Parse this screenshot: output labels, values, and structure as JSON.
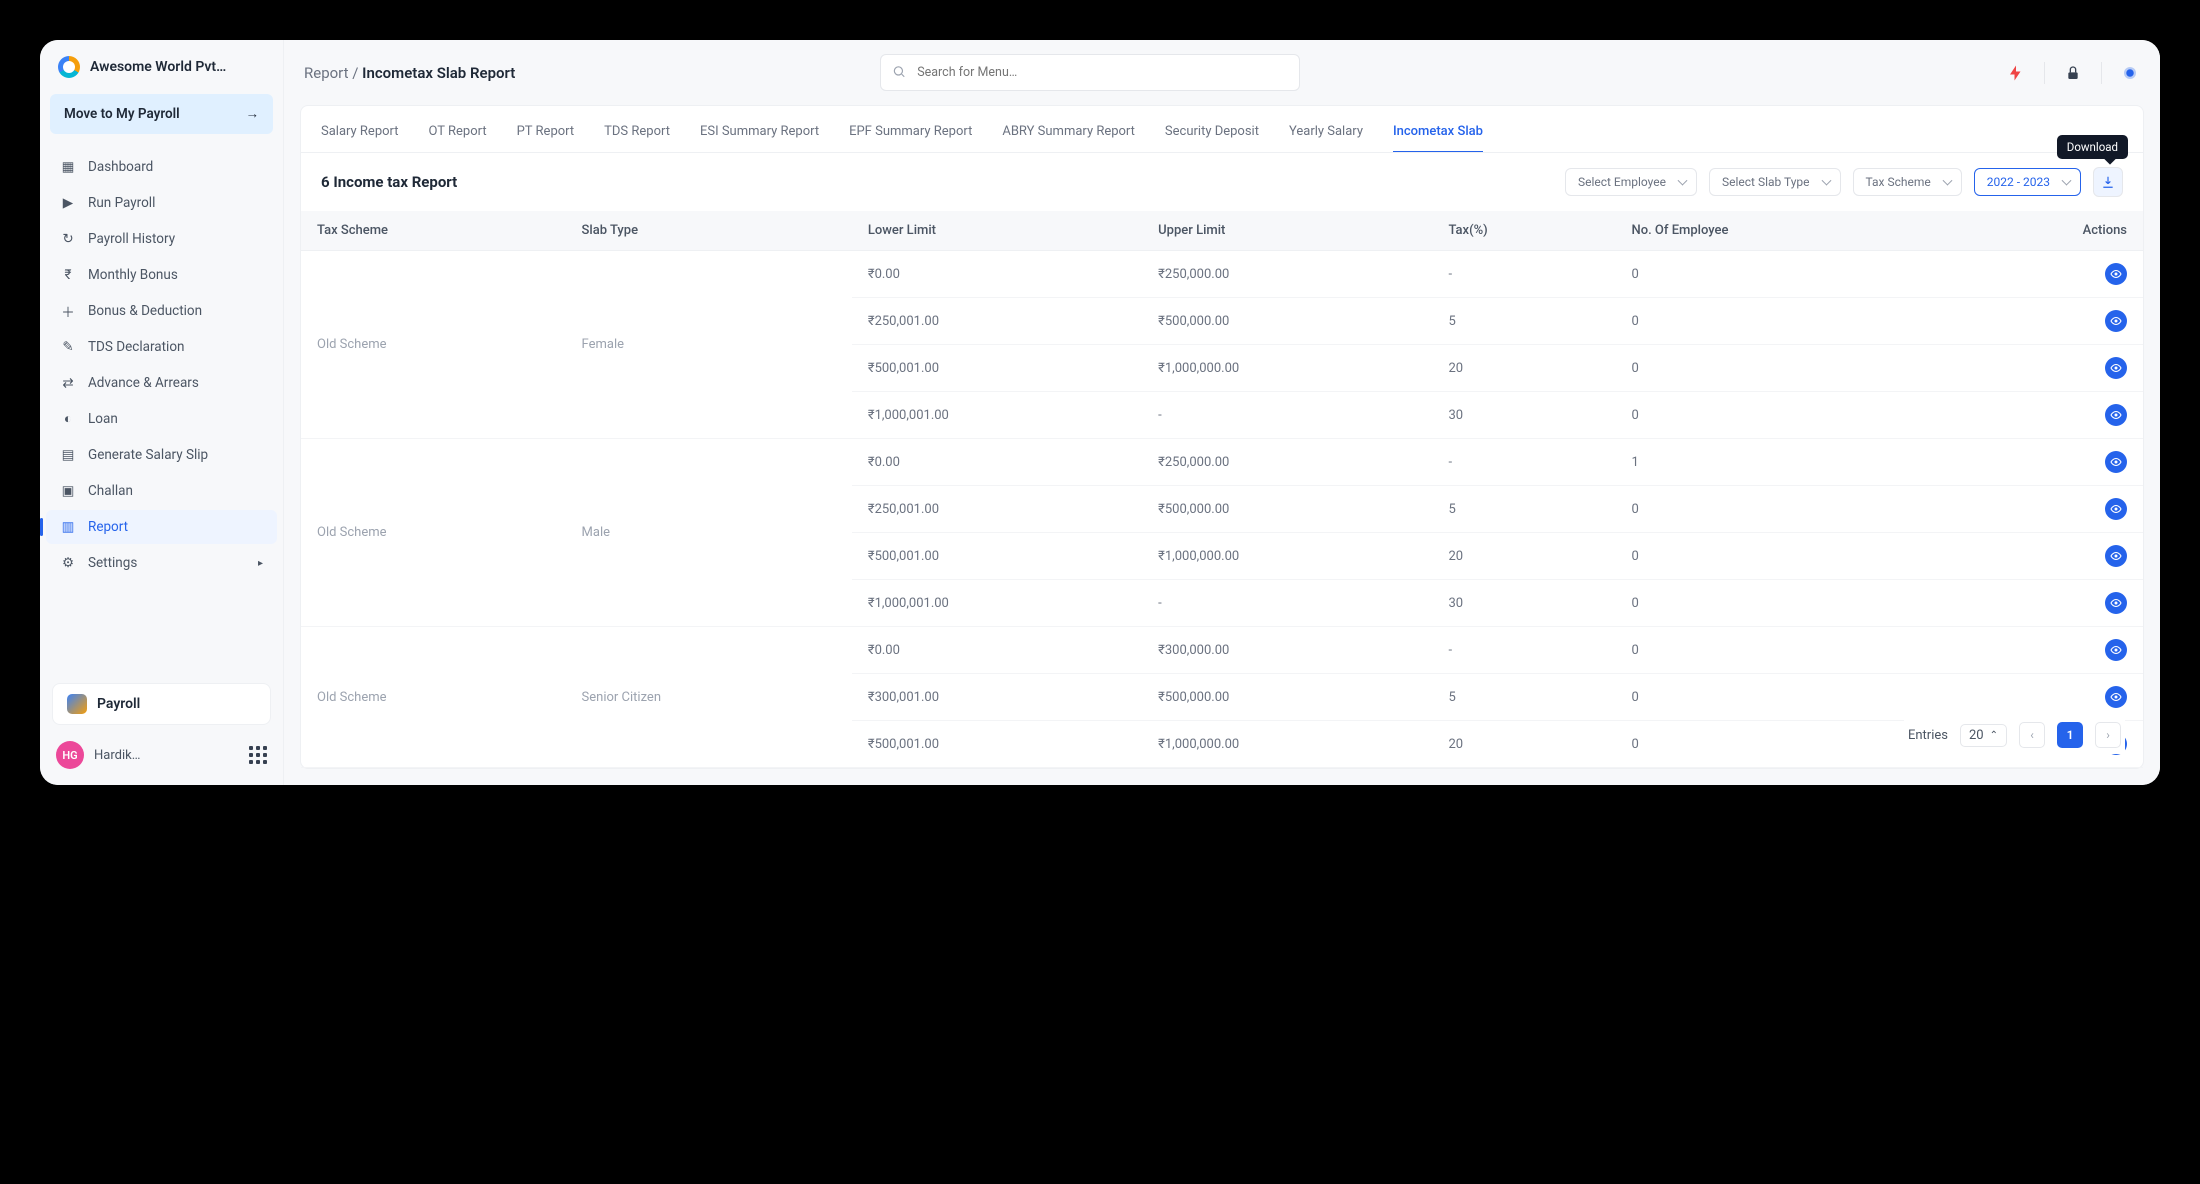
{
  "brand": {
    "name": "Awesome World Pvt…"
  },
  "move_band": {
    "label": "Move to My Payroll"
  },
  "sidebar": {
    "items": [
      {
        "label": "Dashboard"
      },
      {
        "label": "Run Payroll"
      },
      {
        "label": "Payroll History"
      },
      {
        "label": "Monthly Bonus"
      },
      {
        "label": "Bonus & Deduction"
      },
      {
        "label": "TDS Declaration"
      },
      {
        "label": "Advance & Arrears"
      },
      {
        "label": "Loan"
      },
      {
        "label": "Generate Salary Slip"
      },
      {
        "label": "Challan"
      },
      {
        "label": "Report",
        "active": true
      },
      {
        "label": "Settings",
        "children": true
      }
    ]
  },
  "payroll_card": {
    "label": "Payroll"
  },
  "user": {
    "initials": "HG",
    "name": "Hardik…"
  },
  "breadcrumb": {
    "root": "Report",
    "sep": " / ",
    "page": "Incometax Slab Report"
  },
  "search": {
    "placeholder": "Search for Menu…"
  },
  "tabs": [
    "Salary Report",
    "OT Report",
    "PT Report",
    "TDS Report",
    "ESI Summary Report",
    "EPF Summary Report",
    "ABRY Summary Report",
    "Security Deposit",
    "Yearly Salary",
    "Incometax Slab"
  ],
  "active_tab_index": 9,
  "report_title": "6 Income tax Report",
  "filters": {
    "employee": "Select Employee",
    "slab_type": "Select Slab Type",
    "tax_scheme": "Tax Scheme",
    "year": "2022 - 2023"
  },
  "tooltip": "Download",
  "columns": [
    "Tax Scheme",
    "Slab Type",
    "Lower Limit",
    "Upper Limit",
    "Tax(%)",
    "No. Of Employee",
    "Actions"
  ],
  "groups": [
    {
      "tax_scheme": "Old Scheme",
      "slab_type": "Female",
      "rows": [
        {
          "lower": "₹0.00",
          "upper": "₹250,000.00",
          "tax": "-",
          "emp": "0"
        },
        {
          "lower": "₹250,001.00",
          "upper": "₹500,000.00",
          "tax": "5",
          "emp": "0"
        },
        {
          "lower": "₹500,001.00",
          "upper": "₹1,000,000.00",
          "tax": "20",
          "emp": "0"
        },
        {
          "lower": "₹1,000,001.00",
          "upper": "-",
          "tax": "30",
          "emp": "0"
        }
      ]
    },
    {
      "tax_scheme": "Old Scheme",
      "slab_type": "Male",
      "rows": [
        {
          "lower": "₹0.00",
          "upper": "₹250,000.00",
          "tax": "-",
          "emp": "1"
        },
        {
          "lower": "₹250,001.00",
          "upper": "₹500,000.00",
          "tax": "5",
          "emp": "0"
        },
        {
          "lower": "₹500,001.00",
          "upper": "₹1,000,000.00",
          "tax": "20",
          "emp": "0"
        },
        {
          "lower": "₹1,000,001.00",
          "upper": "-",
          "tax": "30",
          "emp": "0"
        }
      ]
    },
    {
      "tax_scheme": "Old Scheme",
      "slab_type": "Senior Citizen",
      "rows": [
        {
          "lower": "₹0.00",
          "upper": "₹300,000.00",
          "tax": "-",
          "emp": "0"
        },
        {
          "lower": "₹300,001.00",
          "upper": "₹500,000.00",
          "tax": "5",
          "emp": "0"
        },
        {
          "lower": "₹500,001.00",
          "upper": "₹1,000,000.00",
          "tax": "20",
          "emp": "0"
        }
      ]
    }
  ],
  "pager": {
    "entries_label": "Entries",
    "entries_value": "20",
    "pages": [
      "1"
    ],
    "active_page": "1"
  }
}
